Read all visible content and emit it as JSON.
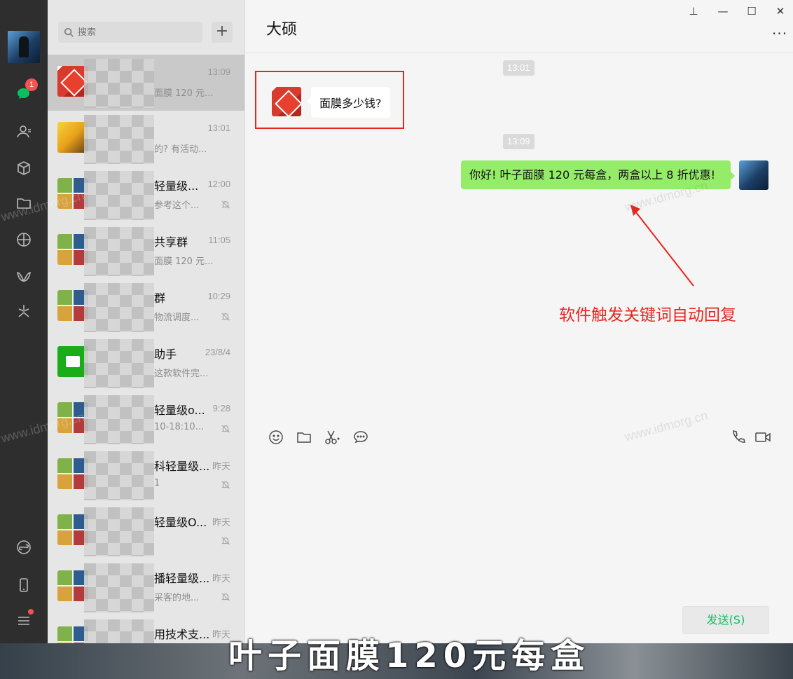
{
  "search": {
    "placeholder": "搜索",
    "add_label": "+"
  },
  "rail": {
    "unread_count": "1"
  },
  "chat_list": [
    {
      "name": "",
      "time": "13:09",
      "preview": "面膜 120 元...",
      "avatar": "red",
      "muted": false,
      "selected": true
    },
    {
      "name": "",
      "time": "13:01",
      "preview": "的? 有活动...",
      "avatar": "yellow",
      "muted": false,
      "selected": false
    },
    {
      "name": "轻量级...",
      "time": "12:00",
      "preview": "参考这个...",
      "avatar": "grid",
      "muted": true,
      "selected": false
    },
    {
      "name": "共享群",
      "time": "11:05",
      "preview": "面膜 120 元...",
      "avatar": "grid",
      "muted": false,
      "selected": false
    },
    {
      "name": "群",
      "time": "10:29",
      "preview": "物流调度...",
      "avatar": "grid",
      "muted": true,
      "selected": false
    },
    {
      "name": "助手",
      "time": "23/8/4",
      "preview": "这款软件完...",
      "avatar": "green",
      "muted": false,
      "selected": false
    },
    {
      "name": "轻量级o...",
      "time": "9:28",
      "preview": "10-18:10...",
      "avatar": "grid",
      "muted": true,
      "selected": false
    },
    {
      "name": "科轻量级...",
      "time": "昨天",
      "preview": "1",
      "avatar": "grid",
      "muted": true,
      "selected": false
    },
    {
      "name": "轻量级O...",
      "time": "昨天",
      "preview": "",
      "avatar": "grid",
      "muted": true,
      "selected": false
    },
    {
      "name": "播轻量级...",
      "time": "昨天",
      "preview": "采客的地...",
      "avatar": "grid",
      "muted": true,
      "selected": false
    },
    {
      "name": "用技术支...",
      "time": "昨天",
      "preview": "",
      "avatar": "grid",
      "muted": false,
      "selected": false
    }
  ],
  "conversation": {
    "title": "大硕",
    "window_buttons": {
      "pin": "⊥",
      "minimize": "—",
      "maximize": "☐",
      "close": "✕"
    },
    "more": "···",
    "time_1": "13:01",
    "incoming_message": "面膜多少钱?",
    "time_2": "13:09",
    "outgoing_message": "你好! 叶子面膜 120 元每盒，两盒以上 8 折优惠!",
    "send_label": "发送(S)"
  },
  "annotation": {
    "text": "软件触发关键词自动回复",
    "color": "#e8261f"
  },
  "watermark": "www.idmorg.cn",
  "caption": "叶子面膜120元每盒",
  "colors": {
    "accent": "#07c160",
    "bubble_out": "#95ec69",
    "badge": "#fa5151"
  }
}
